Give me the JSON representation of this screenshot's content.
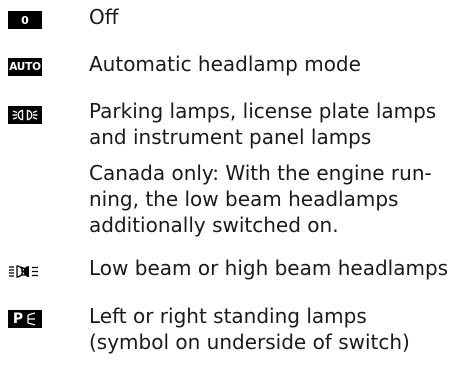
{
  "entries": [
    {
      "symbol": "0",
      "icon": "off-position-icon",
      "lines": [
        "Off"
      ]
    },
    {
      "symbol": "AUTO",
      "icon": "auto-headlamp-icon",
      "lines": [
        "Automatic headlamp mode"
      ]
    },
    {
      "icon": "parking-lamps-icon",
      "lines": [
        "Parking lamps, license plate lamps",
        "and instrument panel lamps"
      ]
    },
    {
      "lines": [
        "Canada only: With the engine run-",
        "ning, the low beam headlamps",
        "additionally switched on."
      ]
    },
    {
      "icon": "low-high-beam-icon",
      "lines": [
        "Low beam or high beam headlamps"
      ]
    },
    {
      "symbol": "P",
      "icon": "standing-lamps-icon",
      "lines": [
        "Left or right standing lamps",
        "(symbol on underside of switch)"
      ]
    }
  ]
}
